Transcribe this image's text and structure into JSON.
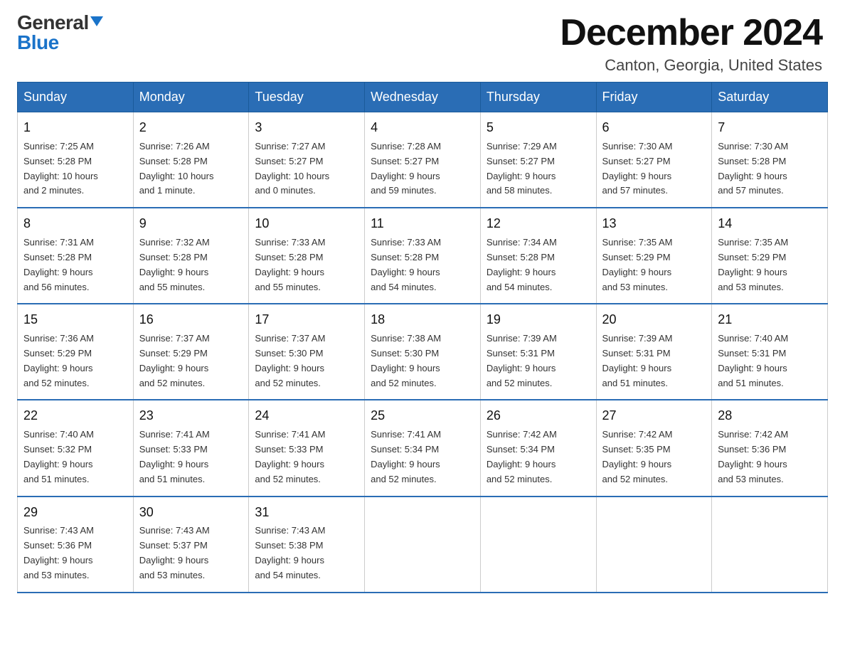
{
  "logo": {
    "general": "General",
    "blue": "Blue"
  },
  "header": {
    "month": "December 2024",
    "location": "Canton, Georgia, United States"
  },
  "days_of_week": [
    "Sunday",
    "Monday",
    "Tuesday",
    "Wednesday",
    "Thursday",
    "Friday",
    "Saturday"
  ],
  "weeks": [
    [
      {
        "day": "1",
        "info": "Sunrise: 7:25 AM\nSunset: 5:28 PM\nDaylight: 10 hours\nand 2 minutes."
      },
      {
        "day": "2",
        "info": "Sunrise: 7:26 AM\nSunset: 5:28 PM\nDaylight: 10 hours\nand 1 minute."
      },
      {
        "day": "3",
        "info": "Sunrise: 7:27 AM\nSunset: 5:27 PM\nDaylight: 10 hours\nand 0 minutes."
      },
      {
        "day": "4",
        "info": "Sunrise: 7:28 AM\nSunset: 5:27 PM\nDaylight: 9 hours\nand 59 minutes."
      },
      {
        "day": "5",
        "info": "Sunrise: 7:29 AM\nSunset: 5:27 PM\nDaylight: 9 hours\nand 58 minutes."
      },
      {
        "day": "6",
        "info": "Sunrise: 7:30 AM\nSunset: 5:27 PM\nDaylight: 9 hours\nand 57 minutes."
      },
      {
        "day": "7",
        "info": "Sunrise: 7:30 AM\nSunset: 5:28 PM\nDaylight: 9 hours\nand 57 minutes."
      }
    ],
    [
      {
        "day": "8",
        "info": "Sunrise: 7:31 AM\nSunset: 5:28 PM\nDaylight: 9 hours\nand 56 minutes."
      },
      {
        "day": "9",
        "info": "Sunrise: 7:32 AM\nSunset: 5:28 PM\nDaylight: 9 hours\nand 55 minutes."
      },
      {
        "day": "10",
        "info": "Sunrise: 7:33 AM\nSunset: 5:28 PM\nDaylight: 9 hours\nand 55 minutes."
      },
      {
        "day": "11",
        "info": "Sunrise: 7:33 AM\nSunset: 5:28 PM\nDaylight: 9 hours\nand 54 minutes."
      },
      {
        "day": "12",
        "info": "Sunrise: 7:34 AM\nSunset: 5:28 PM\nDaylight: 9 hours\nand 54 minutes."
      },
      {
        "day": "13",
        "info": "Sunrise: 7:35 AM\nSunset: 5:29 PM\nDaylight: 9 hours\nand 53 minutes."
      },
      {
        "day": "14",
        "info": "Sunrise: 7:35 AM\nSunset: 5:29 PM\nDaylight: 9 hours\nand 53 minutes."
      }
    ],
    [
      {
        "day": "15",
        "info": "Sunrise: 7:36 AM\nSunset: 5:29 PM\nDaylight: 9 hours\nand 52 minutes."
      },
      {
        "day": "16",
        "info": "Sunrise: 7:37 AM\nSunset: 5:29 PM\nDaylight: 9 hours\nand 52 minutes."
      },
      {
        "day": "17",
        "info": "Sunrise: 7:37 AM\nSunset: 5:30 PM\nDaylight: 9 hours\nand 52 minutes."
      },
      {
        "day": "18",
        "info": "Sunrise: 7:38 AM\nSunset: 5:30 PM\nDaylight: 9 hours\nand 52 minutes."
      },
      {
        "day": "19",
        "info": "Sunrise: 7:39 AM\nSunset: 5:31 PM\nDaylight: 9 hours\nand 52 minutes."
      },
      {
        "day": "20",
        "info": "Sunrise: 7:39 AM\nSunset: 5:31 PM\nDaylight: 9 hours\nand 51 minutes."
      },
      {
        "day": "21",
        "info": "Sunrise: 7:40 AM\nSunset: 5:31 PM\nDaylight: 9 hours\nand 51 minutes."
      }
    ],
    [
      {
        "day": "22",
        "info": "Sunrise: 7:40 AM\nSunset: 5:32 PM\nDaylight: 9 hours\nand 51 minutes."
      },
      {
        "day": "23",
        "info": "Sunrise: 7:41 AM\nSunset: 5:33 PM\nDaylight: 9 hours\nand 51 minutes."
      },
      {
        "day": "24",
        "info": "Sunrise: 7:41 AM\nSunset: 5:33 PM\nDaylight: 9 hours\nand 52 minutes."
      },
      {
        "day": "25",
        "info": "Sunrise: 7:41 AM\nSunset: 5:34 PM\nDaylight: 9 hours\nand 52 minutes."
      },
      {
        "day": "26",
        "info": "Sunrise: 7:42 AM\nSunset: 5:34 PM\nDaylight: 9 hours\nand 52 minutes."
      },
      {
        "day": "27",
        "info": "Sunrise: 7:42 AM\nSunset: 5:35 PM\nDaylight: 9 hours\nand 52 minutes."
      },
      {
        "day": "28",
        "info": "Sunrise: 7:42 AM\nSunset: 5:36 PM\nDaylight: 9 hours\nand 53 minutes."
      }
    ],
    [
      {
        "day": "29",
        "info": "Sunrise: 7:43 AM\nSunset: 5:36 PM\nDaylight: 9 hours\nand 53 minutes."
      },
      {
        "day": "30",
        "info": "Sunrise: 7:43 AM\nSunset: 5:37 PM\nDaylight: 9 hours\nand 53 minutes."
      },
      {
        "day": "31",
        "info": "Sunrise: 7:43 AM\nSunset: 5:38 PM\nDaylight: 9 hours\nand 54 minutes."
      },
      null,
      null,
      null,
      null
    ]
  ]
}
